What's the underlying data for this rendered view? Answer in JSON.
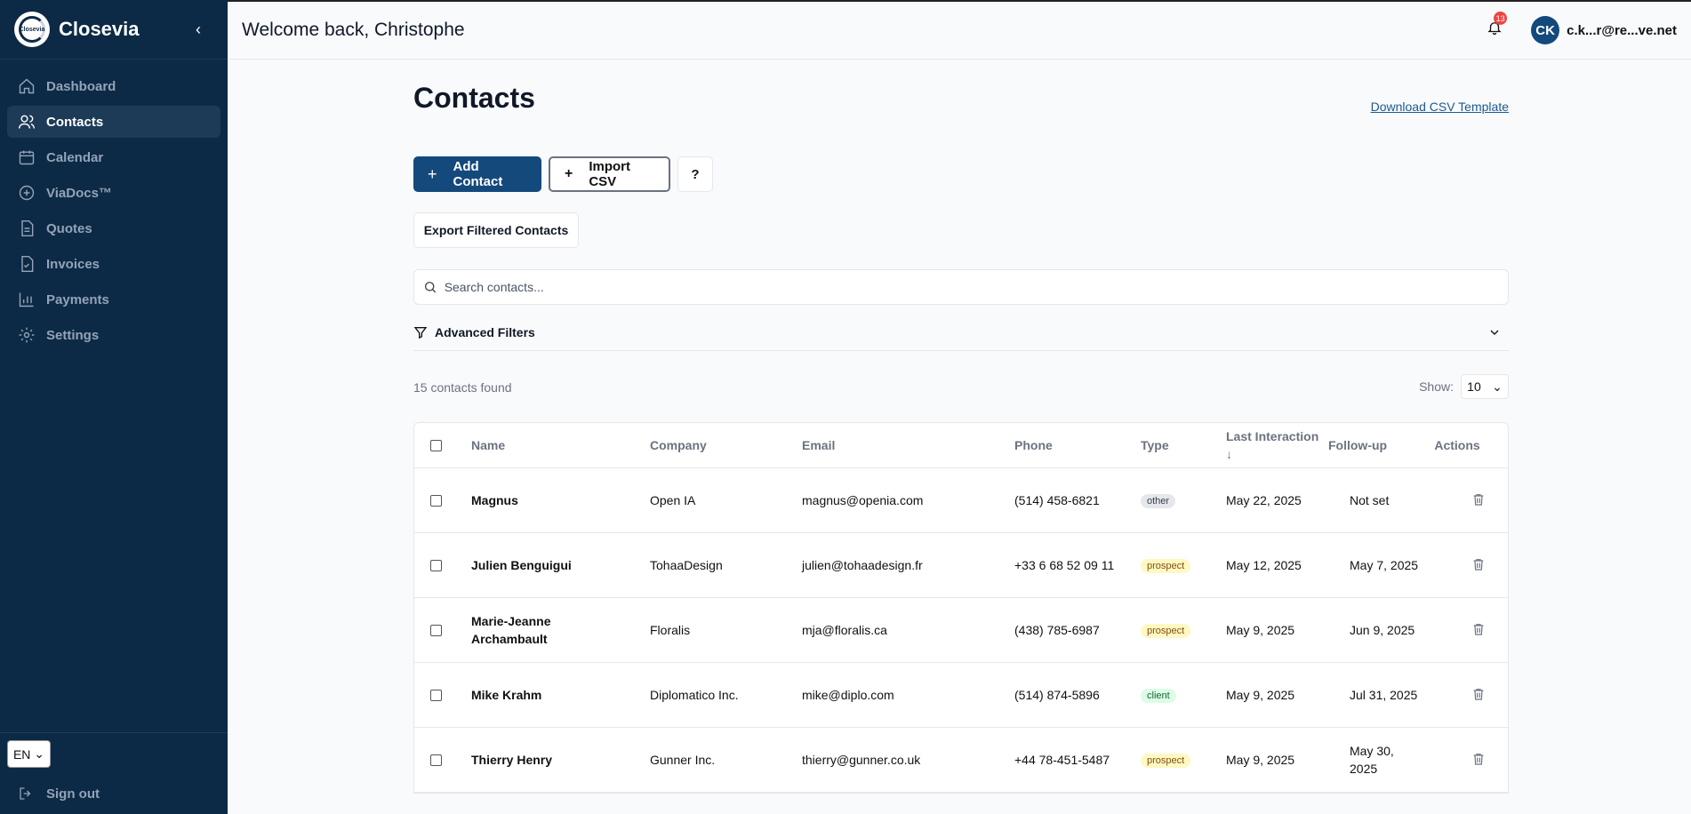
{
  "sidebar": {
    "brand": "Closevia",
    "logo_text": "Closevia",
    "items": [
      {
        "label": "Dashboard",
        "icon": "home-icon"
      },
      {
        "label": "Contacts",
        "icon": "users-icon",
        "active": true
      },
      {
        "label": "Calendar",
        "icon": "calendar-icon"
      },
      {
        "label": "ViaDocs™",
        "icon": "plus-circle-icon"
      },
      {
        "label": "Quotes",
        "icon": "document-icon"
      },
      {
        "label": "Invoices",
        "icon": "invoice-icon"
      },
      {
        "label": "Payments",
        "icon": "chart-icon"
      },
      {
        "label": "Settings",
        "icon": "gear-icon"
      }
    ],
    "language": "EN",
    "sign_out": "Sign out"
  },
  "header": {
    "welcome": "Welcome back, Christophe",
    "notifications": "13",
    "avatar_initials": "CK",
    "user_email": "c.k...r@re...ve.net"
  },
  "main": {
    "title": "Contacts",
    "csv_template_link": "Download CSV Template",
    "add_contact": "Add Contact",
    "import_csv": "Import CSV",
    "help": "?",
    "export_filtered": "Export Filtered Contacts",
    "search_placeholder": "Search contacts...",
    "advanced_filters": "Advanced Filters",
    "count_text": "15 contacts found",
    "show_label": "Show:",
    "show_value": "10"
  },
  "table": {
    "columns": [
      "Name",
      "Company",
      "Email",
      "Phone",
      "Type",
      "Last Interaction ↓",
      "Follow-up",
      "Actions"
    ],
    "rows": [
      {
        "name": "Magnus",
        "company": "Open IA",
        "email": "magnus@openia.com",
        "phone": "(514) 458-6821",
        "type": "other",
        "last": "May 22, 2025",
        "followup": "Not set"
      },
      {
        "name": "Julien Benguigui",
        "company": "TohaaDesign",
        "email": "julien@tohaadesign.fr",
        "phone": "+33 6 68 52 09 11",
        "type": "prospect",
        "last": "May 12, 2025",
        "followup": "May 7, 2025"
      },
      {
        "name": "Marie-Jeanne Archambault",
        "company": "Floralis",
        "email": "mja@floralis.ca",
        "phone": "(438) 785-6987",
        "type": "prospect",
        "last": "May 9, 2025",
        "followup": "Jun 9, 2025"
      },
      {
        "name": "Mike Krahm",
        "company": "Diplomatico Inc.",
        "email": "mike@diplo.com",
        "phone": "(514) 874-5896",
        "type": "client",
        "last": "May 9, 2025",
        "followup": "Jul 31, 2025"
      },
      {
        "name": "Thierry Henry",
        "company": "Gunner Inc.",
        "email": "thierry@gunner.co.uk",
        "phone": "+44 78-451-5487",
        "type": "prospect",
        "last": "May 9, 2025",
        "followup": "May 30, 2025"
      }
    ]
  },
  "colors": {
    "sidebar_bg": "#0c2a45",
    "primary": "#14497b",
    "badge": "#ef4444"
  }
}
